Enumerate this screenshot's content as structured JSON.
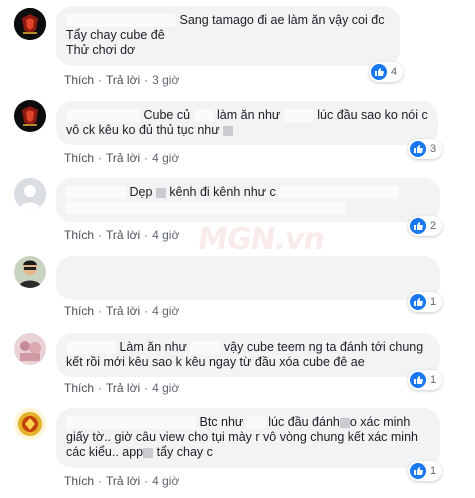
{
  "watermark": "MGN.vn",
  "comments": [
    {
      "avatar": "game-logo-avatar",
      "lines": [
        {
          "text": "Sang tamago đi ae làm ăn vậy coi đc"
        },
        {
          "text": "Tẩy chay cube đê"
        },
        {
          "text": "Thử chơi dơ"
        }
      ],
      "actions": {
        "like": "Thích",
        "reply": "Trả lời",
        "time": "3 giờ"
      },
      "reaction_count": "4"
    },
    {
      "avatar": "game-logo-avatar",
      "lines": [
        {
          "text": "Cube củ"
        },
        {
          "text": "làm ăn như"
        },
        {
          "text": "lúc đầu sao ko nói c"
        },
        {
          "text": "vô ck kêu ko đủ thủ tục như"
        }
      ],
      "actions": {
        "like": "Thích",
        "reply": "Trả lời",
        "time": "4 giờ"
      },
      "reaction_count": "3"
    },
    {
      "avatar": "default-avatar",
      "lines": [
        {
          "text": "Dẹp"
        },
        {
          "text": "kênh đi kênh như c"
        }
      ],
      "actions": {
        "like": "Thích",
        "reply": "Trả lời",
        "time": "4 giờ"
      },
      "reaction_count": "2"
    },
    {
      "avatar": "person-avatar",
      "lines": [],
      "actions": {
        "like": "Thích",
        "reply": "Trả lời",
        "time": "4 giờ"
      },
      "reaction_count": "1"
    },
    {
      "avatar": "blurred-avatar",
      "lines": [
        {
          "text": "Làm ăn như"
        },
        {
          "text": "vậy cube teem ng ta đánh tới chung"
        },
        {
          "text": "kết rồi mới kêu sao k kêu ngay từ đầu xóa cube đê ae"
        }
      ],
      "actions": {
        "like": "Thích",
        "reply": "Trả lời",
        "time": "4 giờ"
      },
      "reaction_count": "1"
    },
    {
      "avatar": "golden-logo-avatar",
      "lines": [
        {
          "text": "Btc như"
        },
        {
          "text": "lúc đầu đánh"
        },
        {
          "text": "o xác minh"
        },
        {
          "text": "giấy tờ.. giờ câu view cho tụi mày r vô vòng chung kết xác minh"
        },
        {
          "text": "các kiểu.. app"
        },
        {
          "text": "tẩy chay c"
        }
      ],
      "actions": {
        "like": "Thích",
        "reply": "Trả lời",
        "time": "4 giờ"
      },
      "reaction_count": "1"
    }
  ]
}
